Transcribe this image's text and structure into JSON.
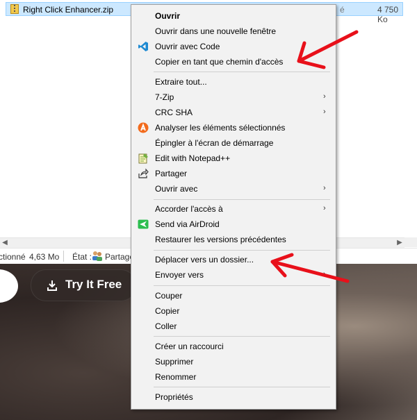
{
  "explorer": {
    "file_name": "Right Click Enhancer.zip",
    "file_type_fragment": "é",
    "file_size": "4 750 Ko"
  },
  "statusbar": {
    "selected_fragment": "ctionné",
    "selected_size": "4,63 Mo",
    "state_label": "État :",
    "shared_fragment": "Partage"
  },
  "banner": {
    "try_button_label": "Try It Free"
  },
  "context_menu": {
    "open": "Ouvrir",
    "open_new_window": "Ouvrir dans une nouvelle fenêtre",
    "open_with_code": "Ouvrir avec Code",
    "copy_as_path": "Copier en tant que chemin d'accès",
    "extract_all": "Extraire tout...",
    "seven_zip": "7-Zip",
    "crc_sha": "CRC SHA",
    "analyze": "Analyser les éléments sélectionnés",
    "pin_start": "Épingler à l'écran de démarrage",
    "edit_notepad": "Edit with Notepad++",
    "share": "Partager",
    "open_with": "Ouvrir avec",
    "grant_access": "Accorder l'accès à",
    "send_airdroid": "Send via AirDroid",
    "restore_versions": "Restaurer les versions précédentes",
    "move_to_folder": "Déplacer vers un dossier...",
    "send_to": "Envoyer vers",
    "cut": "Couper",
    "copy": "Copier",
    "paste": "Coller",
    "create_shortcut": "Créer un raccourci",
    "delete": "Supprimer",
    "rename": "Renommer",
    "properties": "Propriétés",
    "submenu_arrow": "›"
  },
  "colors": {
    "selection": "#cce8ff",
    "menu_bg": "#f2f2f2",
    "annotation_red": "#e8101a",
    "vscode_blue": "#1f8ad2",
    "airdroid_green": "#2bbd4e",
    "avast_orange": "#f26b1d"
  },
  "icons": [
    "zip-icon",
    "vscode-icon",
    "avast-icon",
    "notepad-icon",
    "share-icon",
    "airdroid-icon",
    "download-icon",
    "users-icon"
  ]
}
